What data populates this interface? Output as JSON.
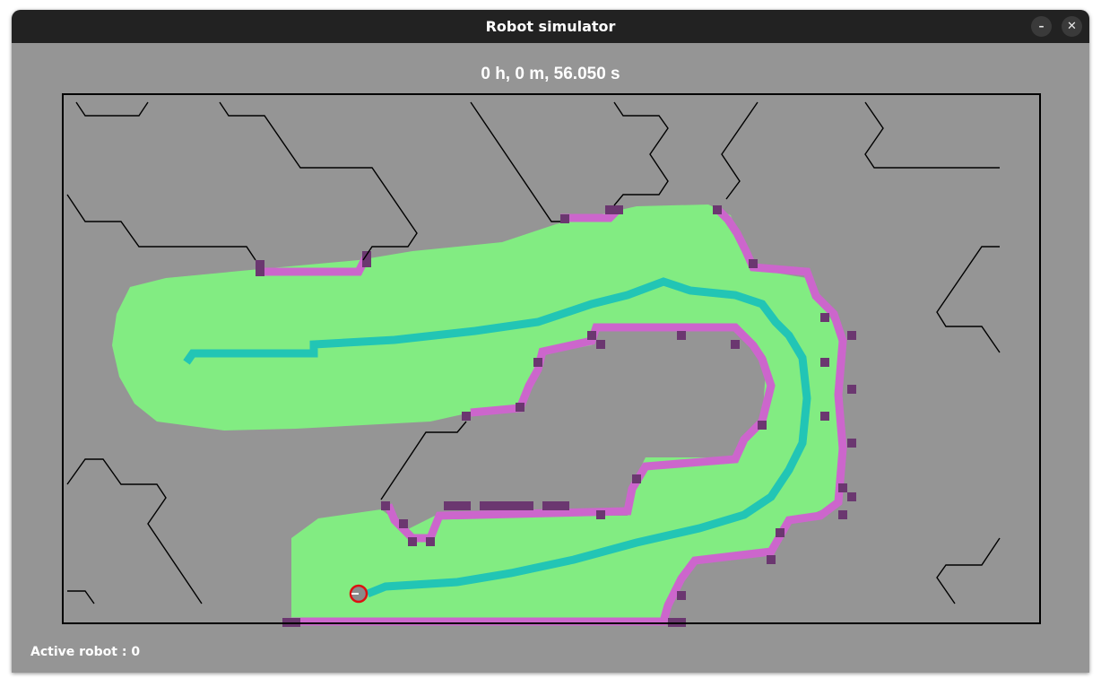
{
  "window": {
    "title": "Robot simulator"
  },
  "titlebar": {
    "minimize_glyph": "–",
    "close_glyph": "✕"
  },
  "simulator": {
    "timer": "0 h, 0 m, 56.050 s",
    "status": "Active robot : 0",
    "robot_count_active": 0
  },
  "colors": {
    "background": "#959595",
    "explored": "#82ec82",
    "path": "#22c5b5",
    "detected_wall": "#cc66cc",
    "dark_wall": "#6b3770",
    "robot_body": "#8a8a8a",
    "robot_outline": "#dd1111",
    "walls": "#000000"
  },
  "icons": {
    "minimize": "minimize-icon",
    "close": "close-icon",
    "robot": "robot-icon"
  }
}
